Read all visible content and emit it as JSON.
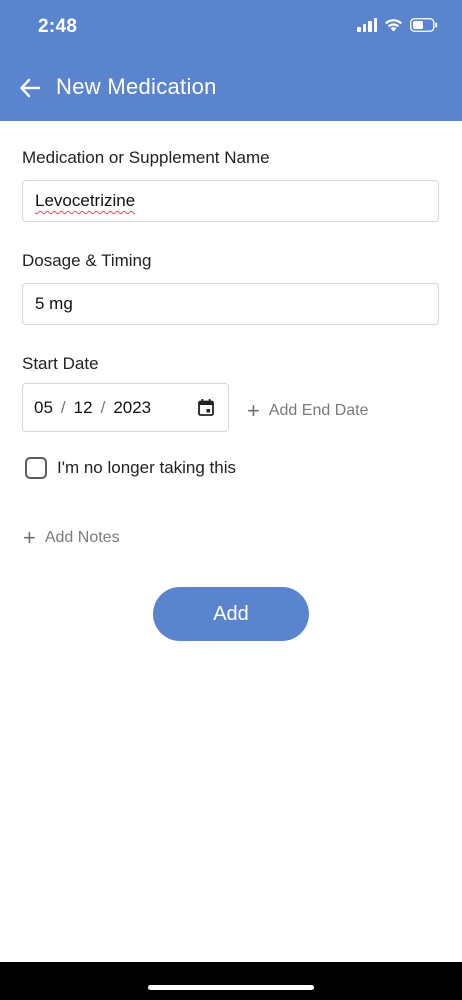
{
  "status_bar": {
    "time": "2:48",
    "icons": [
      "cellular-signal-icon",
      "wifi-icon",
      "battery-icon"
    ]
  },
  "header": {
    "title": "New Medication",
    "background_color": "#5b84cf",
    "back_icon": "arrow-left-icon"
  },
  "form": {
    "name_label": "Medication or Supplement Name",
    "name_value": "Levocetrizine",
    "dosage_label": "Dosage & Timing",
    "dosage_value": "5 mg",
    "start_date_label": "Start Date",
    "start_date": {
      "month": "05",
      "day": "12",
      "year": "2023",
      "separator": "/"
    },
    "add_end_date": "Add End Date",
    "no_longer_taking": "I'm no longer taking this",
    "no_longer_taking_checked": false,
    "add_notes": "Add Notes",
    "submit_label": "Add"
  }
}
